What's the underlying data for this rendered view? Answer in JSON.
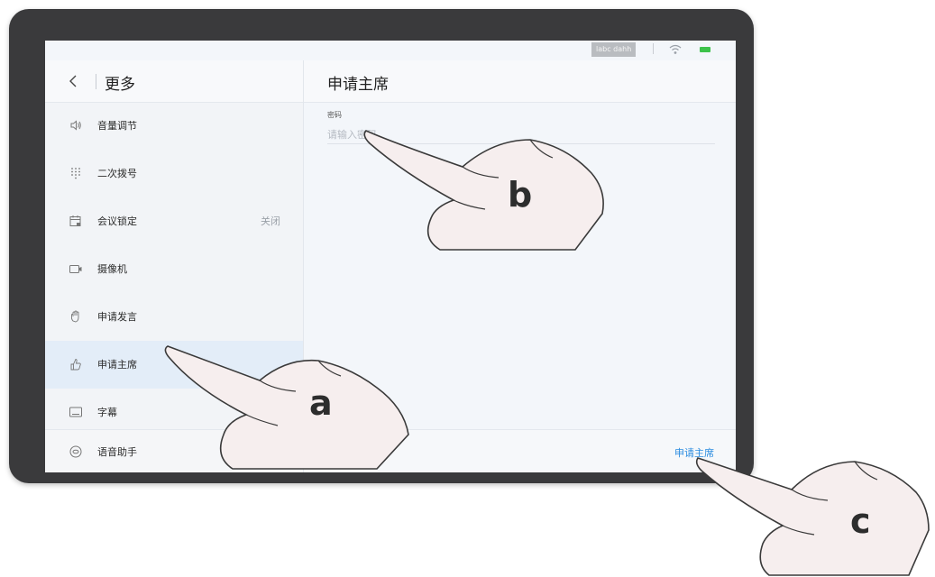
{
  "status": {
    "tag": "labc dahh"
  },
  "left_panel": {
    "title": "更多",
    "items": [
      {
        "label": "音量调节",
        "value": "",
        "icon": "speaker-icon"
      },
      {
        "label": "二次拨号",
        "value": "",
        "icon": "dialpad-icon"
      },
      {
        "label": "会议锁定",
        "value": "关闭",
        "icon": "calendar-lock-icon"
      },
      {
        "label": "摄像机",
        "value": "",
        "icon": "camera-icon"
      },
      {
        "label": "申请发言",
        "value": "",
        "icon": "hand-raise-icon"
      },
      {
        "label": "申请主席",
        "value": "",
        "icon": "thumb-up-icon"
      },
      {
        "label": "字幕",
        "value": "",
        "icon": "subtitle-icon"
      },
      {
        "label": "语音助手",
        "value": "",
        "icon": "voice-assistant-icon"
      }
    ],
    "selected_index": 5
  },
  "right_panel": {
    "title": "申请主席",
    "password_label": "密码",
    "password_placeholder": "请输入密码",
    "password_value": "",
    "apply_button": "申请主席"
  },
  "callouts": {
    "a": "a",
    "b": "b",
    "c": "c"
  },
  "colors": {
    "accent": "#2b8ce0",
    "selected_bg": "#e3edf8",
    "battery": "#3dc24b",
    "bezel": "#3a3a3c"
  }
}
